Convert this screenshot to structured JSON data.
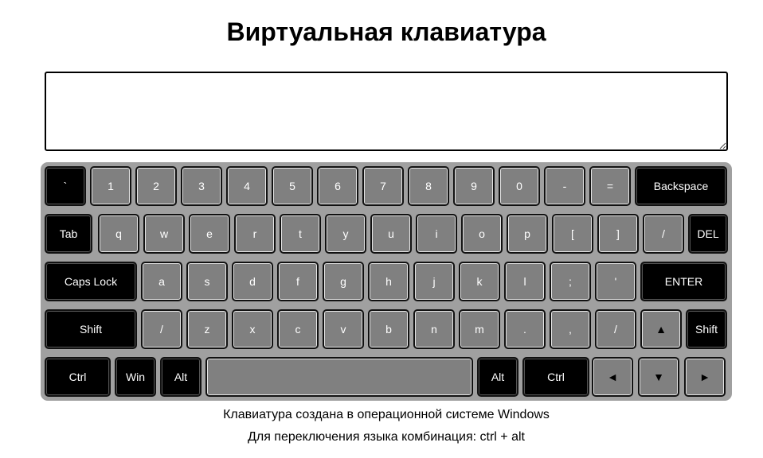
{
  "page": {
    "title": "Виртуальная клавиатура",
    "input": {
      "value": "",
      "placeholder": ""
    },
    "notes": [
      "Клавиатура создана в операционной системе Windows",
      "Для переключения языка комбинация: ctrl + alt"
    ]
  },
  "keyboard": {
    "rows": [
      [
        {
          "label": "`",
          "name": "key-backtick",
          "dark": true
        },
        {
          "label": "1",
          "name": "key-1"
        },
        {
          "label": "2",
          "name": "key-2"
        },
        {
          "label": "3",
          "name": "key-3"
        },
        {
          "label": "4",
          "name": "key-4"
        },
        {
          "label": "5",
          "name": "key-5"
        },
        {
          "label": "6",
          "name": "key-6"
        },
        {
          "label": "7",
          "name": "key-7"
        },
        {
          "label": "8",
          "name": "key-8"
        },
        {
          "label": "9",
          "name": "key-9"
        },
        {
          "label": "0",
          "name": "key-0"
        },
        {
          "label": "-",
          "name": "key-minus"
        },
        {
          "label": "=",
          "name": "key-equals"
        },
        {
          "label": "Backspace",
          "name": "key-backspace",
          "dark": true
        }
      ],
      [
        {
          "label": "Tab",
          "name": "key-tab",
          "dark": true
        },
        {
          "label": "q",
          "name": "key-q"
        },
        {
          "label": "w",
          "name": "key-w"
        },
        {
          "label": "e",
          "name": "key-e"
        },
        {
          "label": "r",
          "name": "key-r"
        },
        {
          "label": "t",
          "name": "key-t"
        },
        {
          "label": "y",
          "name": "key-y"
        },
        {
          "label": "u",
          "name": "key-u"
        },
        {
          "label": "i",
          "name": "key-i"
        },
        {
          "label": "o",
          "name": "key-o"
        },
        {
          "label": "p",
          "name": "key-p"
        },
        {
          "label": "[",
          "name": "key-left-bracket"
        },
        {
          "label": "]",
          "name": "key-right-bracket"
        },
        {
          "label": "/",
          "name": "key-slash-top"
        },
        {
          "label": "DEL",
          "name": "key-del",
          "dark": true
        }
      ],
      [
        {
          "label": "Caps Lock",
          "name": "key-caps-lock",
          "dark": true
        },
        {
          "label": "a",
          "name": "key-a"
        },
        {
          "label": "s",
          "name": "key-s"
        },
        {
          "label": "d",
          "name": "key-d"
        },
        {
          "label": "f",
          "name": "key-f"
        },
        {
          "label": "g",
          "name": "key-g"
        },
        {
          "label": "h",
          "name": "key-h"
        },
        {
          "label": "j",
          "name": "key-j"
        },
        {
          "label": "k",
          "name": "key-k"
        },
        {
          "label": "l",
          "name": "key-l"
        },
        {
          "label": ";",
          "name": "key-semicolon"
        },
        {
          "label": "'",
          "name": "key-quote"
        },
        {
          "label": "ENTER",
          "name": "key-enter",
          "dark": true
        }
      ],
      [
        {
          "label": "Shift",
          "name": "key-shift-left",
          "dark": true
        },
        {
          "label": "/",
          "name": "key-slash-left"
        },
        {
          "label": "z",
          "name": "key-z"
        },
        {
          "label": "x",
          "name": "key-x"
        },
        {
          "label": "c",
          "name": "key-c"
        },
        {
          "label": "v",
          "name": "key-v"
        },
        {
          "label": "b",
          "name": "key-b"
        },
        {
          "label": "n",
          "name": "key-n"
        },
        {
          "label": "m",
          "name": "key-m"
        },
        {
          "label": ".",
          "name": "key-period"
        },
        {
          "label": ",",
          "name": "key-comma"
        },
        {
          "label": "/",
          "name": "key-slash"
        },
        {
          "label": "▲",
          "name": "arrow-up-icon",
          "icon": "arrow-up"
        },
        {
          "label": "Shift",
          "name": "key-shift-right",
          "dark": true
        }
      ],
      [
        {
          "label": "Ctrl",
          "name": "key-ctrl-left",
          "dark": true
        },
        {
          "label": "Win",
          "name": "key-win",
          "dark": true
        },
        {
          "label": "Alt",
          "name": "key-alt-left",
          "dark": true
        },
        {
          "label": "",
          "name": "key-space"
        },
        {
          "label": "Alt",
          "name": "key-alt-right",
          "dark": true
        },
        {
          "label": "Ctrl",
          "name": "key-ctrl-right",
          "dark": true
        },
        {
          "label": "◄",
          "name": "arrow-left-icon",
          "icon": "arrow-left"
        },
        {
          "label": "▼",
          "name": "arrow-down-icon",
          "icon": "arrow-down"
        },
        {
          "label": "►",
          "name": "arrow-right-icon",
          "icon": "arrow-right"
        }
      ]
    ]
  },
  "colors": {
    "key_light": "#808080",
    "key_dark": "#000000",
    "keyboard_background": "#a0a0a0"
  }
}
